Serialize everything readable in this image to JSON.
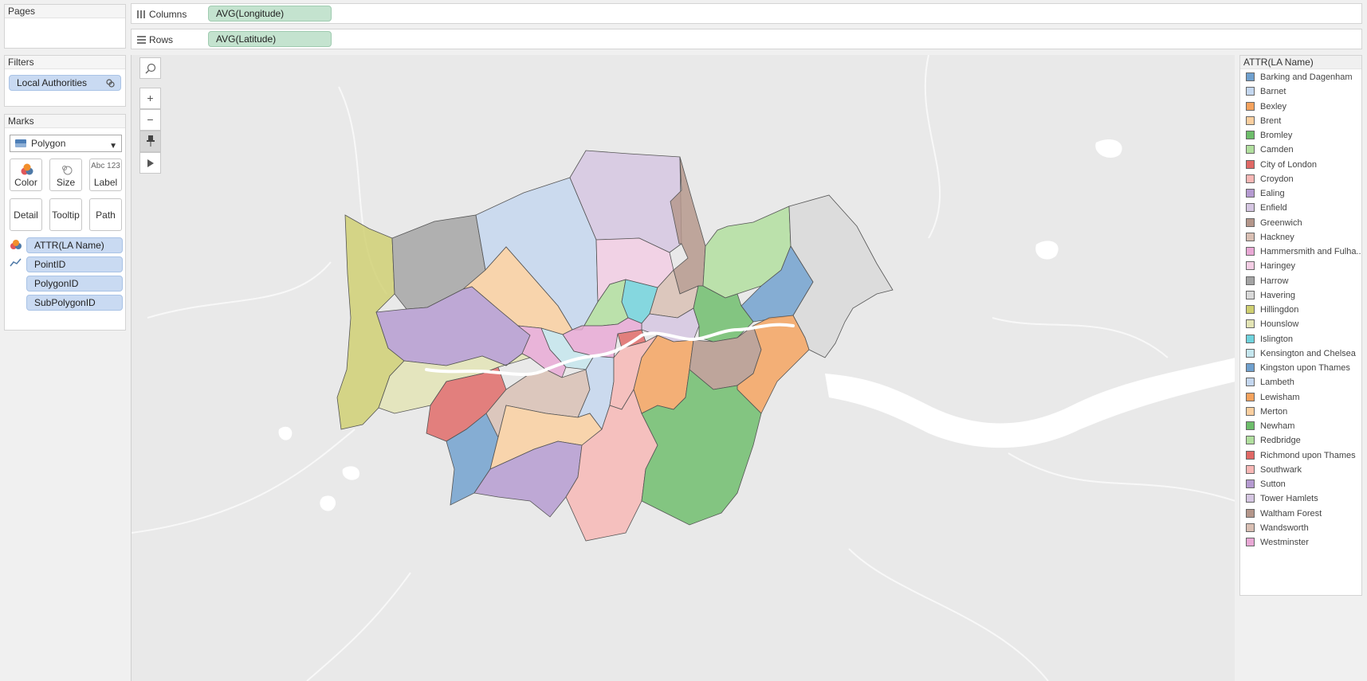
{
  "panels": {
    "pages_title": "Pages",
    "filters_title": "Filters",
    "marks_title": "Marks"
  },
  "filters": {
    "local_authorities": "Local Authorities"
  },
  "shelves": {
    "columns_label": "Columns",
    "columns_pill": "AVG(Longitude)",
    "rows_label": "Rows",
    "rows_pill": "AVG(Latitude)"
  },
  "marks": {
    "type": "Polygon",
    "buttons": [
      "Color",
      "Size",
      "Label",
      "Detail",
      "Tooltip",
      "Path"
    ],
    "label_icon_text": "Abc 123",
    "fields": [
      "ATTR(LA Name)",
      "PointID",
      "PolygonID",
      "SubPolygonID"
    ]
  },
  "map_tools": {
    "zoom_in": "+",
    "zoom_out": "−"
  },
  "legend": {
    "title": "ATTR(LA Name)",
    "items": [
      {
        "name": "Barking and Dagenham",
        "color": "#6fa0ce"
      },
      {
        "name": "Barnet",
        "color": "#c4d7ef"
      },
      {
        "name": "Bexley",
        "color": "#f5a25d"
      },
      {
        "name": "Brent",
        "color": "#fbcf9f"
      },
      {
        "name": "Bromley",
        "color": "#6dbd6a"
      },
      {
        "name": "Camden",
        "color": "#b1df9e"
      },
      {
        "name": "City of London",
        "color": "#e06865"
      },
      {
        "name": "Croydon",
        "color": "#f8b7b5"
      },
      {
        "name": "Ealing",
        "color": "#b59ad1"
      },
      {
        "name": "Enfield",
        "color": "#d5c6e2"
      },
      {
        "name": "Greenwich",
        "color": "#b4968a"
      },
      {
        "name": "Hackney",
        "color": "#d9bfb3"
      },
      {
        "name": "Hammersmith and Fulha..",
        "color": "#e9a8d5"
      },
      {
        "name": "Haringey",
        "color": "#f3cde4"
      },
      {
        "name": "Harrow",
        "color": "#a3a3a3"
      },
      {
        "name": "Havering",
        "color": "#d9d9d9"
      },
      {
        "name": "Hillingdon",
        "color": "#cfcf70"
      },
      {
        "name": "Hounslow",
        "color": "#e3e4b5"
      },
      {
        "name": "Islington",
        "color": "#6fd3dd"
      },
      {
        "name": "Kensington and Chelsea",
        "color": "#c5e6ee"
      },
      {
        "name": "Kingston upon Thames",
        "color": "#6fa0ce"
      },
      {
        "name": "Lambeth",
        "color": "#c4d7ef"
      },
      {
        "name": "Lewisham",
        "color": "#f5a25d"
      },
      {
        "name": "Merton",
        "color": "#fbcf9f"
      },
      {
        "name": "Newham",
        "color": "#6dbd6a"
      },
      {
        "name": "Redbridge",
        "color": "#b1df9e"
      },
      {
        "name": "Richmond upon Thames",
        "color": "#e06865"
      },
      {
        "name": "Southwark",
        "color": "#f8b7b5"
      },
      {
        "name": "Sutton",
        "color": "#b59ad1"
      },
      {
        "name": "Tower Hamlets",
        "color": "#d5c6e2"
      },
      {
        "name": "Waltham Forest",
        "color": "#b4968a"
      },
      {
        "name": "Wandsworth",
        "color": "#d9bfb3"
      },
      {
        "name": "Westminster",
        "color": "#e9a8d5"
      }
    ]
  }
}
